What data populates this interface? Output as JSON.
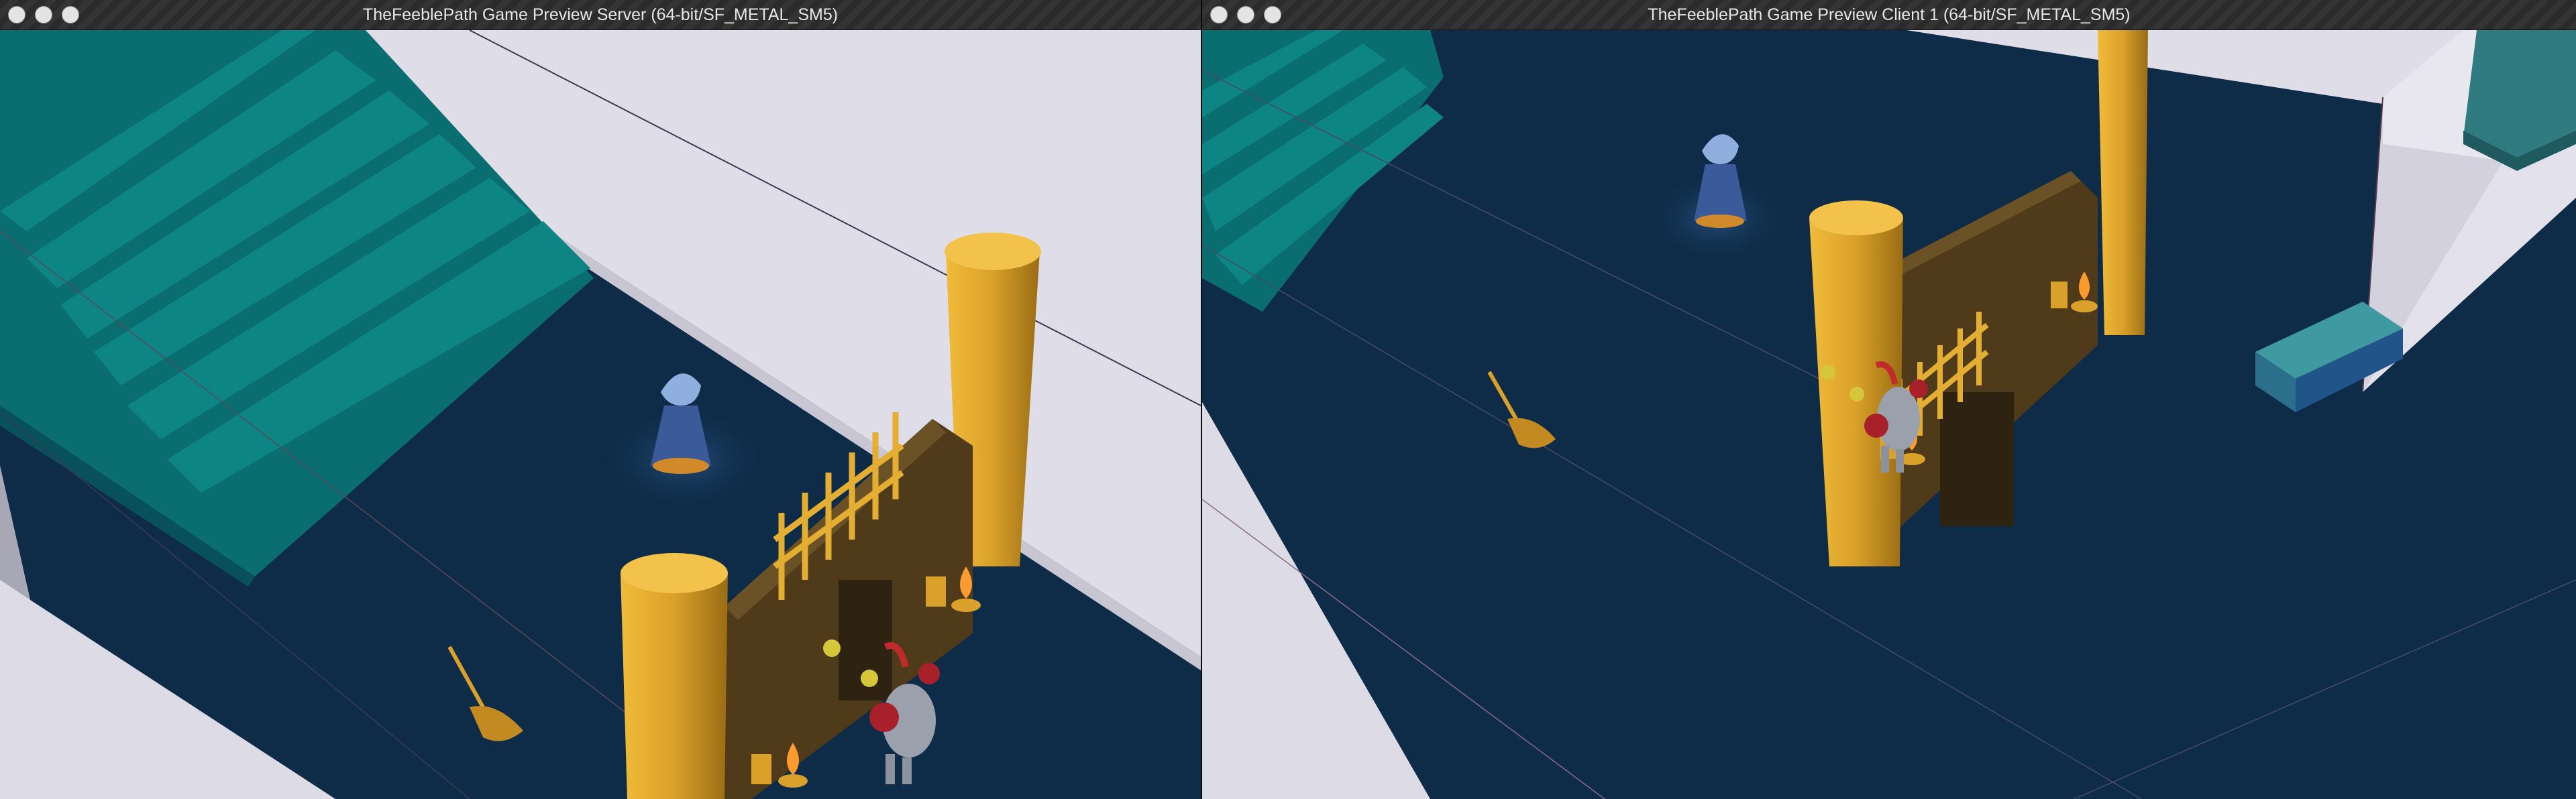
{
  "windows": [
    {
      "title": "TheFeeblePath Game Preview Server (64-bit/SF_METAL_SM5)",
      "controls": [
        "close-icon",
        "minimize-icon",
        "zoom-icon"
      ]
    },
    {
      "title": "TheFeeblePath Game Preview Client 1 (64-bit/SF_METAL_SM5)",
      "controls": [
        "close-icon",
        "minimize-icon",
        "zoom-icon"
      ]
    }
  ],
  "colors": {
    "floor": "#0d2a45",
    "wall": "#dcdbe6",
    "stairs": "#0a7a7a",
    "pillar": "#d9a12a",
    "gate": "#5a4420",
    "torch_flame": "#ff9a2e",
    "mage_robe": "#3a5a9a",
    "knight_armor": "#9aa1ad"
  }
}
